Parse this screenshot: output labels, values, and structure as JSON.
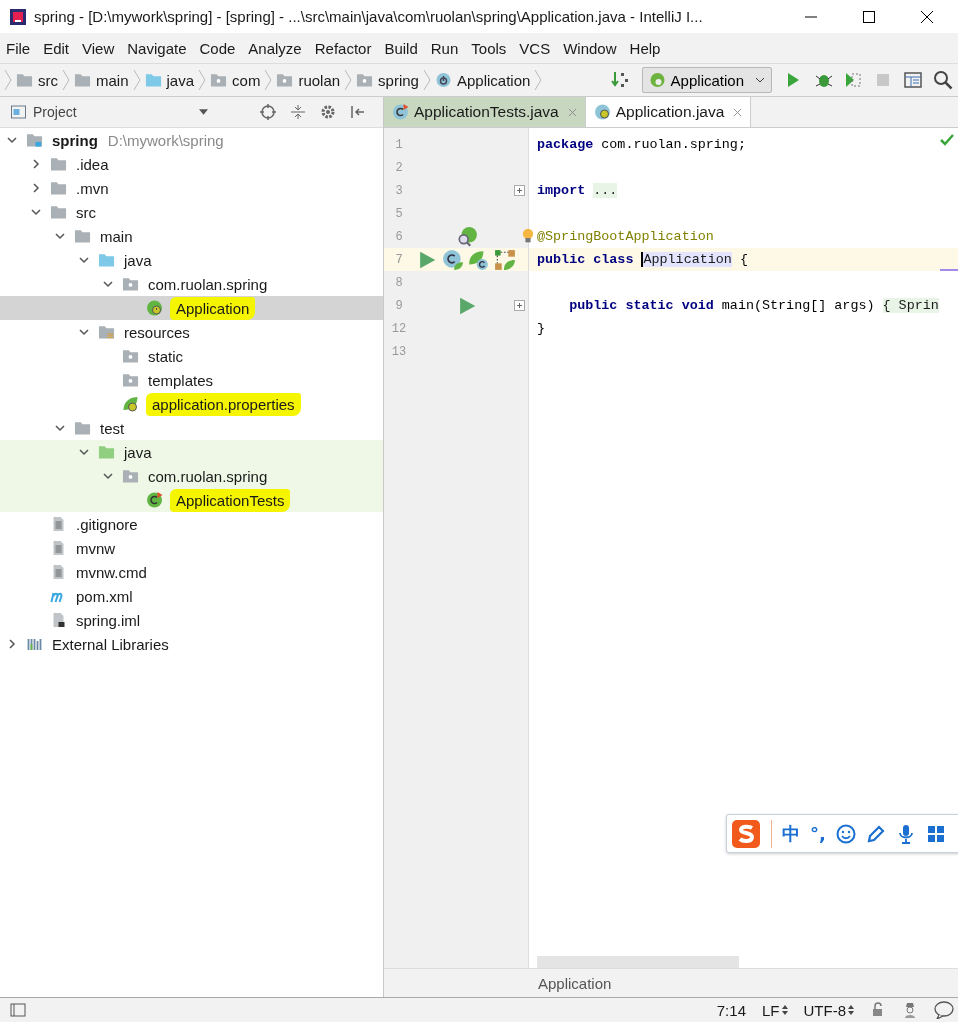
{
  "window": {
    "title": "spring - [D:\\mywork\\spring] - [spring] - ...\\src\\main\\java\\com\\ruolan\\spring\\Application.java - IntelliJ I..."
  },
  "menu": [
    "File",
    "Edit",
    "View",
    "Navigate",
    "Code",
    "Analyze",
    "Refactor",
    "Build",
    "Run",
    "Tools",
    "VCS",
    "Window",
    "Help"
  ],
  "breadcrumbs": [
    {
      "label": "src",
      "kind": "folder"
    },
    {
      "label": "main",
      "kind": "folder"
    },
    {
      "label": "java",
      "kind": "source"
    },
    {
      "label": "com",
      "kind": "package"
    },
    {
      "label": "ruolan",
      "kind": "package"
    },
    {
      "label": "spring",
      "kind": "package"
    },
    {
      "label": "Application",
      "kind": "spring-class"
    }
  ],
  "run_config": {
    "label": "Application"
  },
  "project_panel": {
    "title": "Project"
  },
  "tree": [
    {
      "name": "spring",
      "path": "D:\\mywork\\spring",
      "kind": "module",
      "expanded": true,
      "selected": false,
      "highlighted": false,
      "tinted": false,
      "children": [
        {
          "name": ".idea",
          "kind": "folder",
          "expanded": false,
          "selected": false,
          "highlighted": false,
          "tinted": false
        },
        {
          "name": ".mvn",
          "kind": "folder",
          "expanded": false,
          "selected": false,
          "highlighted": false,
          "tinted": false
        },
        {
          "name": "src",
          "kind": "folder",
          "expanded": true,
          "selected": false,
          "highlighted": false,
          "tinted": false,
          "children": [
            {
              "name": "main",
              "kind": "folder",
              "expanded": true,
              "selected": false,
              "highlighted": false,
              "tinted": false,
              "children": [
                {
                  "name": "java",
                  "kind": "source",
                  "expanded": true,
                  "selected": false,
                  "highlighted": false,
                  "tinted": false,
                  "children": [
                    {
                      "name": "com.ruolan.spring",
                      "kind": "package",
                      "expanded": true,
                      "selected": false,
                      "highlighted": false,
                      "tinted": false,
                      "children": [
                        {
                          "name": "Application",
                          "kind": "spring-class",
                          "selected": true,
                          "highlighted": true,
                          "tinted": false
                        }
                      ]
                    }
                  ]
                },
                {
                  "name": "resources",
                  "kind": "resources",
                  "expanded": true,
                  "selected": false,
                  "highlighted": false,
                  "tinted": false,
                  "children": [
                    {
                      "name": "static",
                      "kind": "package",
                      "selected": false,
                      "highlighted": false,
                      "tinted": false
                    },
                    {
                      "name": "templates",
                      "kind": "package",
                      "selected": false,
                      "highlighted": false,
                      "tinted": false
                    },
                    {
                      "name": "application.properties",
                      "kind": "properties",
                      "selected": false,
                      "highlighted": true,
                      "tinted": false
                    }
                  ]
                }
              ]
            },
            {
              "name": "test",
              "kind": "folder",
              "expanded": true,
              "selected": false,
              "highlighted": false,
              "tinted": false,
              "children": [
                {
                  "name": "java",
                  "kind": "test-source",
                  "expanded": true,
                  "selected": false,
                  "highlighted": false,
                  "tinted": true,
                  "children": [
                    {
                      "name": "com.ruolan.spring",
                      "kind": "package",
                      "expanded": true,
                      "selected": false,
                      "highlighted": false,
                      "tinted": true,
                      "children": [
                        {
                          "name": "ApplicationTests",
                          "kind": "test-class",
                          "selected": false,
                          "highlighted": true,
                          "tinted": true
                        }
                      ]
                    }
                  ]
                }
              ]
            }
          ]
        },
        {
          "name": ".gitignore",
          "kind": "file",
          "selected": false,
          "highlighted": false,
          "tinted": false
        },
        {
          "name": "mvnw",
          "kind": "file",
          "selected": false,
          "highlighted": false,
          "tinted": false
        },
        {
          "name": "mvnw.cmd",
          "kind": "file",
          "selected": false,
          "highlighted": false,
          "tinted": false
        },
        {
          "name": "pom.xml",
          "kind": "maven",
          "selected": false,
          "highlighted": false,
          "tinted": false
        },
        {
          "name": "spring.iml",
          "kind": "iml",
          "selected": false,
          "highlighted": false,
          "tinted": false
        }
      ]
    },
    {
      "name": "External Libraries",
      "kind": "libraries",
      "expanded": false,
      "selected": false,
      "highlighted": false,
      "tinted": false
    }
  ],
  "tabs": [
    {
      "label": "ApplicationTests.java",
      "kind": "test-class",
      "selected": false
    },
    {
      "label": "Application.java",
      "kind": "spring-class",
      "selected": true
    }
  ],
  "code": [
    {
      "number": "1",
      "segments": [
        {
          "text": "package",
          "kind": "keyword"
        },
        {
          "text": "com.ruolan.spring;",
          "kind": "plain",
          "spaced": true
        }
      ]
    },
    {
      "number": "2"
    },
    {
      "number": "3",
      "fold": true,
      "segments": [
        {
          "text": "import",
          "kind": "keyword"
        },
        {
          "text": "...",
          "kind": "folded",
          "spaced": true
        }
      ]
    },
    {
      "number": "5"
    },
    {
      "number": "6",
      "gutter": [
        {
          "kind": "bean-search"
        }
      ],
      "bulb": true,
      "segments": [
        {
          "text": "@SpringBootApplication",
          "kind": "annotation"
        }
      ]
    },
    {
      "number": "7",
      "current": true,
      "gutter": [
        {
          "kind": "run"
        },
        {
          "kind": "class-bean"
        },
        {
          "kind": "spring-bean"
        },
        {
          "kind": "diagram"
        }
      ],
      "segments": [
        {
          "text": "public class",
          "kind": "keyword"
        },
        {
          "text": "Application",
          "kind": "usage",
          "spaced": true
        },
        {
          "text": "{",
          "kind": "plain",
          "spaced": true
        }
      ]
    },
    {
      "number": "8"
    },
    {
      "number": "9",
      "fold": true,
      "indented": true,
      "gutter": [
        {
          "kind": "run-indent"
        }
      ],
      "segments": [
        {
          "text": "public static void",
          "kind": "keyword"
        },
        {
          "text": "main(String[] args)",
          "kind": "plain",
          "spaced": true
        },
        {
          "text": "{ Sprin",
          "kind": "folded",
          "spaced": true
        }
      ]
    },
    {
      "number": "12",
      "segments": [
        {
          "text": "}",
          "kind": "plain"
        }
      ]
    },
    {
      "number": "13"
    }
  ],
  "editor_breadcrumb": "Application",
  "ime_toolbar": {
    "items": [
      "中",
      "°,"
    ]
  },
  "status_bar": {
    "position": "7:14",
    "line_separator": "LF",
    "encoding": "UTF-8"
  }
}
